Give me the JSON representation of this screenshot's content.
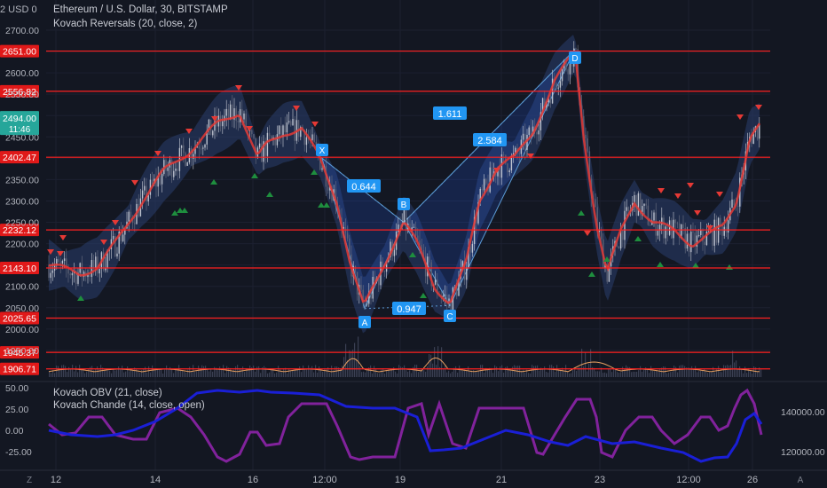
{
  "header": {
    "currency": "2 USD 0",
    "symbol_line": "Ethereum / U.S. Dollar, 30, BITSTAMP",
    "indicator1": "Kovach Reversals (20, close, 2)",
    "indicator2": "Kovach OBV (21, close)",
    "indicator3": "Kovach Chande (14, close, open)"
  },
  "price_axis": {
    "ticks": [
      "2700.00",
      "2600.00",
      "2550.00",
      "2500.00",
      "2450.00",
      "2350.00",
      "2300.00",
      "2250.00",
      "2200.00",
      "2100.00",
      "2050.00",
      "2000.00",
      "1950.00"
    ],
    "current_price": "2494.00",
    "countdown": "11:46"
  },
  "levels": [
    "2651.00",
    "2556.82",
    "2402.47",
    "2232.12",
    "2143.10",
    "2025.65",
    "1945.37",
    "1906.71"
  ],
  "pattern": {
    "points": [
      {
        "label": "X",
        "value": 2400
      },
      {
        "label": "A",
        "value": 2048
      },
      {
        "label": "B",
        "value": 2250
      },
      {
        "label": "C",
        "value": 2055
      },
      {
        "label": "D",
        "value": 2655
      }
    ],
    "ratios": [
      "0.644",
      "0.947",
      "1.611",
      "2.584"
    ]
  },
  "lower_pane": {
    "left_ticks": [
      "50.00",
      "25.00",
      "0.00",
      "-25.00"
    ],
    "right_ticks": [
      "140000.00",
      "120000.00"
    ]
  },
  "time_axis": {
    "labels": [
      "12",
      "14",
      "16",
      "12:00",
      "19",
      "21",
      "23",
      "12:00",
      "26"
    ]
  },
  "colors": {
    "background": "#131722",
    "level_line": "#ff2020",
    "candle_up": "#bfc4d0",
    "ma_line": "#e53935",
    "band_fill": "#2a3e6e",
    "pattern_label": "#2196f3",
    "down_marker": "#e53935",
    "up_marker": "#1e8e3e",
    "obv_line": "#1a1fd6",
    "chande_line": "#8e24aa",
    "volume_line": "#e8a060",
    "current_price_tag": "#26a69a"
  },
  "icons": {
    "zoom": "Z",
    "auto": "A"
  }
}
